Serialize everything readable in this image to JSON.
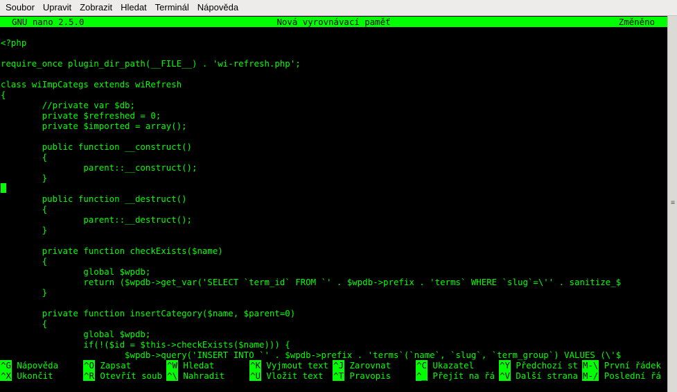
{
  "menubar": {
    "items": [
      "Soubor",
      "Upravit",
      "Zobrazit",
      "Hledat",
      "Terminál",
      "Nápověda"
    ]
  },
  "nano": {
    "version": "GNU nano 2.5.0",
    "buffer_name": "Nová vyrovnávací paměť",
    "status": "Změněno"
  },
  "code_lines": [
    "",
    "<?php",
    "",
    "require_once plugin_dir_path(__FILE__) . 'wi-refresh.php';",
    "",
    "class wiImpCategs extends wiRefresh",
    "{",
    "        //private var $db;",
    "        private $refreshed = 0;",
    "        private $imported = array();",
    "",
    "        public function __construct()",
    "        {",
    "                parent::__construct();",
    "        }",
    "",
    "        public function __destruct()",
    "        {",
    "                parent::__destruct();",
    "        }",
    "",
    "        private function checkExists($name)",
    "        {",
    "                global $wpdb;",
    "                return ($wpdb->get_var('SELECT `term_id` FROM `' . $wpdb->prefix . 'terms` WHERE `slug`=\\'' . sanitize_$",
    "        }",
    "",
    "        private function insertCategory($name, $parent=0)",
    "        {",
    "                global $wpdb;",
    "                if(!($id = $this->checkExists($name))) {",
    "                        $wpdb->query('INSERT INTO `' . $wpdb->prefix . 'terms`(`name`, `slug`, `term_group`) VALUES (\\'$"
  ],
  "shortcuts": [
    [
      {
        "key": "^G",
        "label": "Nápověda"
      },
      {
        "key": "^O",
        "label": "Zapsat"
      },
      {
        "key": "^W",
        "label": "Hledat"
      },
      {
        "key": "^K",
        "label": "Vyjmout text"
      },
      {
        "key": "^J",
        "label": "Zarovnat"
      },
      {
        "key": "^C",
        "label": "Ukazatel"
      },
      {
        "key": "^Y",
        "label": "Předchozí st"
      },
      {
        "key": "M-\\",
        "label": "První řádek"
      }
    ],
    [
      {
        "key": "^X",
        "label": "Ukončit"
      },
      {
        "key": "^R",
        "label": "Otevřít soub"
      },
      {
        "key": "^\\",
        "label": "Nahradit"
      },
      {
        "key": "^U",
        "label": "Vložit text"
      },
      {
        "key": "^T",
        "label": "Pravopis"
      },
      {
        "key": "^_",
        "label": "Přejít na řá"
      },
      {
        "key": "^V",
        "label": "Další strana"
      },
      {
        "key": "M-/",
        "label": "Poslední řá"
      }
    ]
  ],
  "scrollbar": {
    "grip_icon": "scroll-grip-icon"
  },
  "colors": {
    "terminal_fg": "#00ff00",
    "terminal_bg": "#000000"
  }
}
